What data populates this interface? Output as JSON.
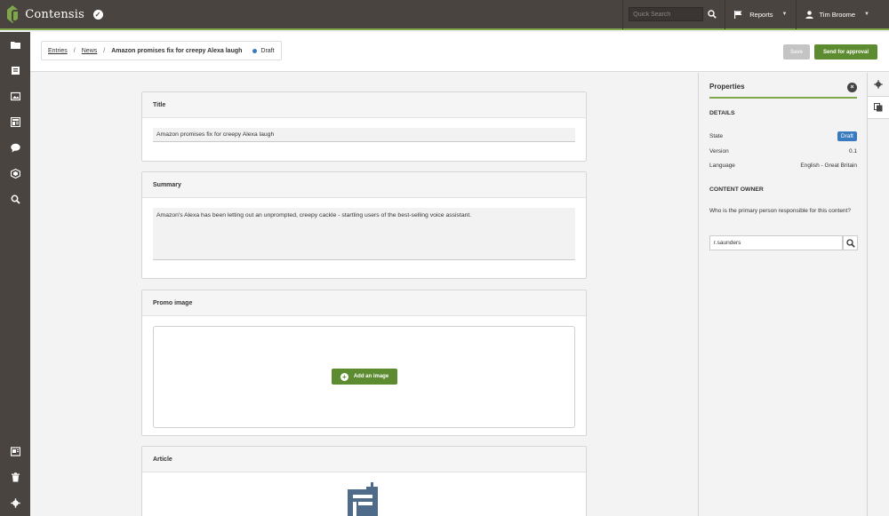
{
  "app": {
    "name": "Contensis"
  },
  "topbar": {
    "search_placeholder": "Quick Search",
    "reports_label": "Reports",
    "user_name": "Tim Broome"
  },
  "breadcrumb": {
    "items": [
      "Entries",
      "News"
    ],
    "current": "Amazon promises fix for creepy Alexa laugh",
    "status": "Draft"
  },
  "actions": {
    "save_label": "Save",
    "send_label": "Send for approval"
  },
  "fields": {
    "title": {
      "label": "Title",
      "value": "Amazon promises fix for creepy Alexa laugh"
    },
    "summary": {
      "label": "Summary",
      "value": "Amazon's Alexa has been letting out an unprompted, creepy cackle - startling users of the best-selling voice assistant."
    },
    "promo_image": {
      "label": "Promo image",
      "add_label": "Add an image"
    },
    "article": {
      "label": "Article"
    }
  },
  "properties": {
    "title": "Properties",
    "details_heading": "DETAILS",
    "rows": [
      {
        "label": "State",
        "value": "Draft"
      },
      {
        "label": "Version",
        "value": "0.1"
      },
      {
        "label": "Language",
        "value": "English - Great Britain"
      }
    ],
    "owner_heading": "CONTENT OWNER",
    "owner_question": "Who is the primary person responsible for this content?",
    "owner_value": "r.saunders"
  },
  "colors": {
    "topbar": "#4a4440",
    "accent_green": "#5d8b2f",
    "draft_blue": "#3a7bbf"
  }
}
